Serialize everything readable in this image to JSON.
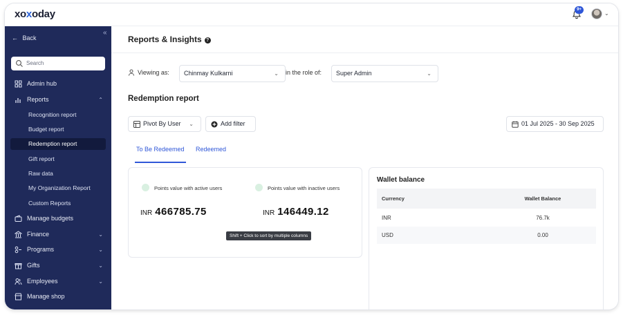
{
  "brand": {
    "logo_pre": "xo",
    "logo_mid": "x",
    "logo_post": "oday"
  },
  "header": {
    "notification_count": "9+"
  },
  "sidebar": {
    "back_label": "Back",
    "search_placeholder": "Search",
    "items": [
      {
        "label": "Admin hub",
        "icon": "grid-icon"
      },
      {
        "label": "Reports",
        "icon": "chart-icon",
        "expanded": true
      },
      {
        "label": "Manage budgets",
        "icon": "wallet-icon"
      },
      {
        "label": "Finance",
        "icon": "bank-icon"
      },
      {
        "label": "Programs",
        "icon": "programs-icon"
      },
      {
        "label": "Gifts",
        "icon": "gift-icon"
      },
      {
        "label": "Employees",
        "icon": "users-icon"
      },
      {
        "label": "Manage shop",
        "icon": "shop-icon"
      }
    ],
    "report_links": [
      "Recognition report",
      "Budget report",
      "Redemption report",
      "Gift report",
      "Raw data",
      "My Organization Report",
      "Custom Reports"
    ],
    "active_report": "Redemption report"
  },
  "page": {
    "title": "Reports & Insights",
    "viewing_as_label": "Viewing as:",
    "viewing_as_value": "Chinmay Kulkarni",
    "role_label": "in the role of:",
    "role_value": "Super Admin",
    "section_title": "Redemption report",
    "pivot_label": "Pivot By User",
    "add_filter_label": "Add filter",
    "date_range": "01 Jul 2025 - 30 Sep 2025",
    "tabs": [
      {
        "label": "To Be Redeemed",
        "active": true
      },
      {
        "label": "Redeemed",
        "active": false
      }
    ]
  },
  "points": {
    "active_label": "Points value with active users",
    "active_currency": "INR",
    "active_amount": "466785.75",
    "inactive_label": "Points value with inactive users",
    "inactive_currency": "INR",
    "inactive_amount": "146449.12"
  },
  "tooltip": "Shift + Click to sort by multiple columns",
  "wallet": {
    "title": "Wallet balance",
    "columns": [
      "Currency",
      "Wallet Balance"
    ],
    "rows": [
      {
        "currency": "INR",
        "balance": "76.7k"
      },
      {
        "currency": "USD",
        "balance": "0.00"
      }
    ]
  },
  "colors": {
    "sidebar": "#1f2a5a",
    "accent": "#2f57d8",
    "active_item": "#121a3d"
  }
}
